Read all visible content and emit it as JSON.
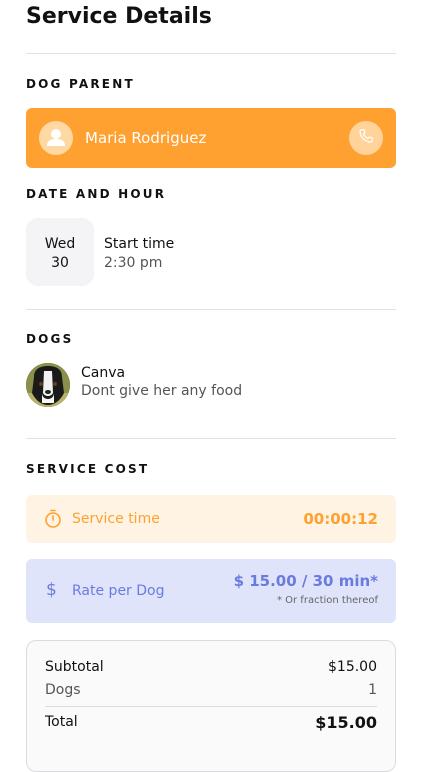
{
  "header": {
    "title": "Service Details"
  },
  "dog_parent": {
    "section_label": "DOG PARENT",
    "name": "Maria Rodriguez",
    "accent_color": "#ffa130",
    "avatar_icon": "person-icon",
    "call_icon": "phone-icon"
  },
  "date_hour": {
    "section_label": "DATE AND HOUR",
    "day": "Wed",
    "date": "30",
    "start_label": "Start time",
    "start_value": "2:30 pm"
  },
  "dogs": {
    "section_label": "DOGS",
    "items": [
      {
        "name": "Canva",
        "note": "Dont give her any food"
      }
    ]
  },
  "service_cost": {
    "section_label": "SERVICE COST",
    "time": {
      "label": "Service time",
      "value": "00:00:12",
      "icon": "stopwatch-icon",
      "color": "#ffa130"
    },
    "rate": {
      "label": "Rate per Dog",
      "value": "$ 15.00 / 30 min*",
      "note": "* Or fraction thereof",
      "icon": "dollar-icon",
      "color": "#6a7be0"
    }
  },
  "summary": {
    "subtotal_label": "Subtotal",
    "subtotal_value": "$15.00",
    "dogs_label": "Dogs",
    "dogs_value": "1",
    "total_label": "Total",
    "total_value": "$15.00"
  }
}
